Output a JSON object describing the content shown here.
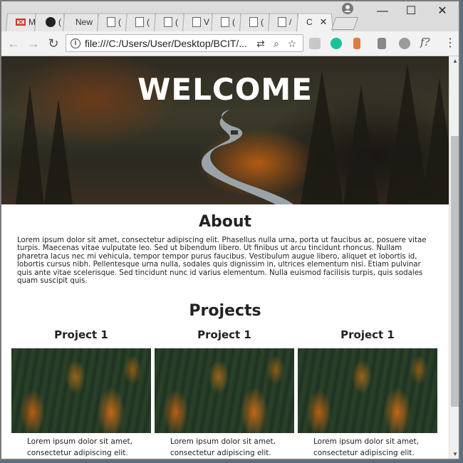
{
  "browser": {
    "tabs": [
      {
        "label": "M",
        "icon": "gmail-icon"
      },
      {
        "label": "(",
        "icon": "github-icon"
      },
      {
        "label": "New",
        "icon": "page-icon"
      },
      {
        "label": "(",
        "icon": "page-icon"
      },
      {
        "label": "(",
        "icon": "page-icon"
      },
      {
        "label": "(",
        "icon": "page-icon"
      },
      {
        "label": "V",
        "icon": "page-icon"
      },
      {
        "label": "(",
        "icon": "page-icon"
      },
      {
        "label": "(",
        "icon": "page-icon"
      },
      {
        "label": "/",
        "icon": "page-icon"
      },
      {
        "label": "C",
        "icon": "page-icon",
        "active": true
      }
    ],
    "address": "file:///C:/Users/User/Desktop/BCIT/...",
    "window_controls": {
      "minimize": "—",
      "maximize": "☐",
      "close": "✕"
    },
    "extensions": [
      "translate-icon",
      "zoom-icon",
      "star-icon",
      "pdf-icon",
      "grammarly-icon",
      "tag-icon",
      "eyedropper-icon",
      "gear-icon",
      "formula-icon",
      "menu-icon"
    ]
  },
  "page": {
    "hero_title": "WELCOME",
    "about_heading": "About",
    "about_text": "Lorem ipsum dolor sit amet, consectetur adipiscing elit. Phasellus nulla urna, porta ut faucibus ac, posuere vitae turpis. Maecenas vitae vulputate leo. Sed ut bibendum libero. Ut finibus ut arcu tincidunt rhoncus. Nullam pharetra lacus nec mi vehicula, tempor tempor purus faucibus. Vestibulum augue libero, aliquet et lobortis id, lobortis cursus nibh. Pellentesque urna nulla, sodales quis dignissim in, ultrices elementum nisi. Etiam pulvinar quis ante vitae scelerisque. Sed tincidunt nunc id varius elementum. Nulla euismod facilisis turpis, quis sodales quam suscipit quis.",
    "projects_heading": "Projects",
    "projects": [
      {
        "title": "Project 1",
        "text": "Lorem ipsum dolor sit amet, consectetur adipiscing elit. Phasellus"
      },
      {
        "title": "Project 1",
        "text": "Lorem ipsum dolor sit amet, consectetur adipiscing elit. Phasellus"
      },
      {
        "title": "Project 1",
        "text": "Lorem ipsum dolor sit amet, consectetur adipiscing elit. Phasellus"
      }
    ]
  }
}
